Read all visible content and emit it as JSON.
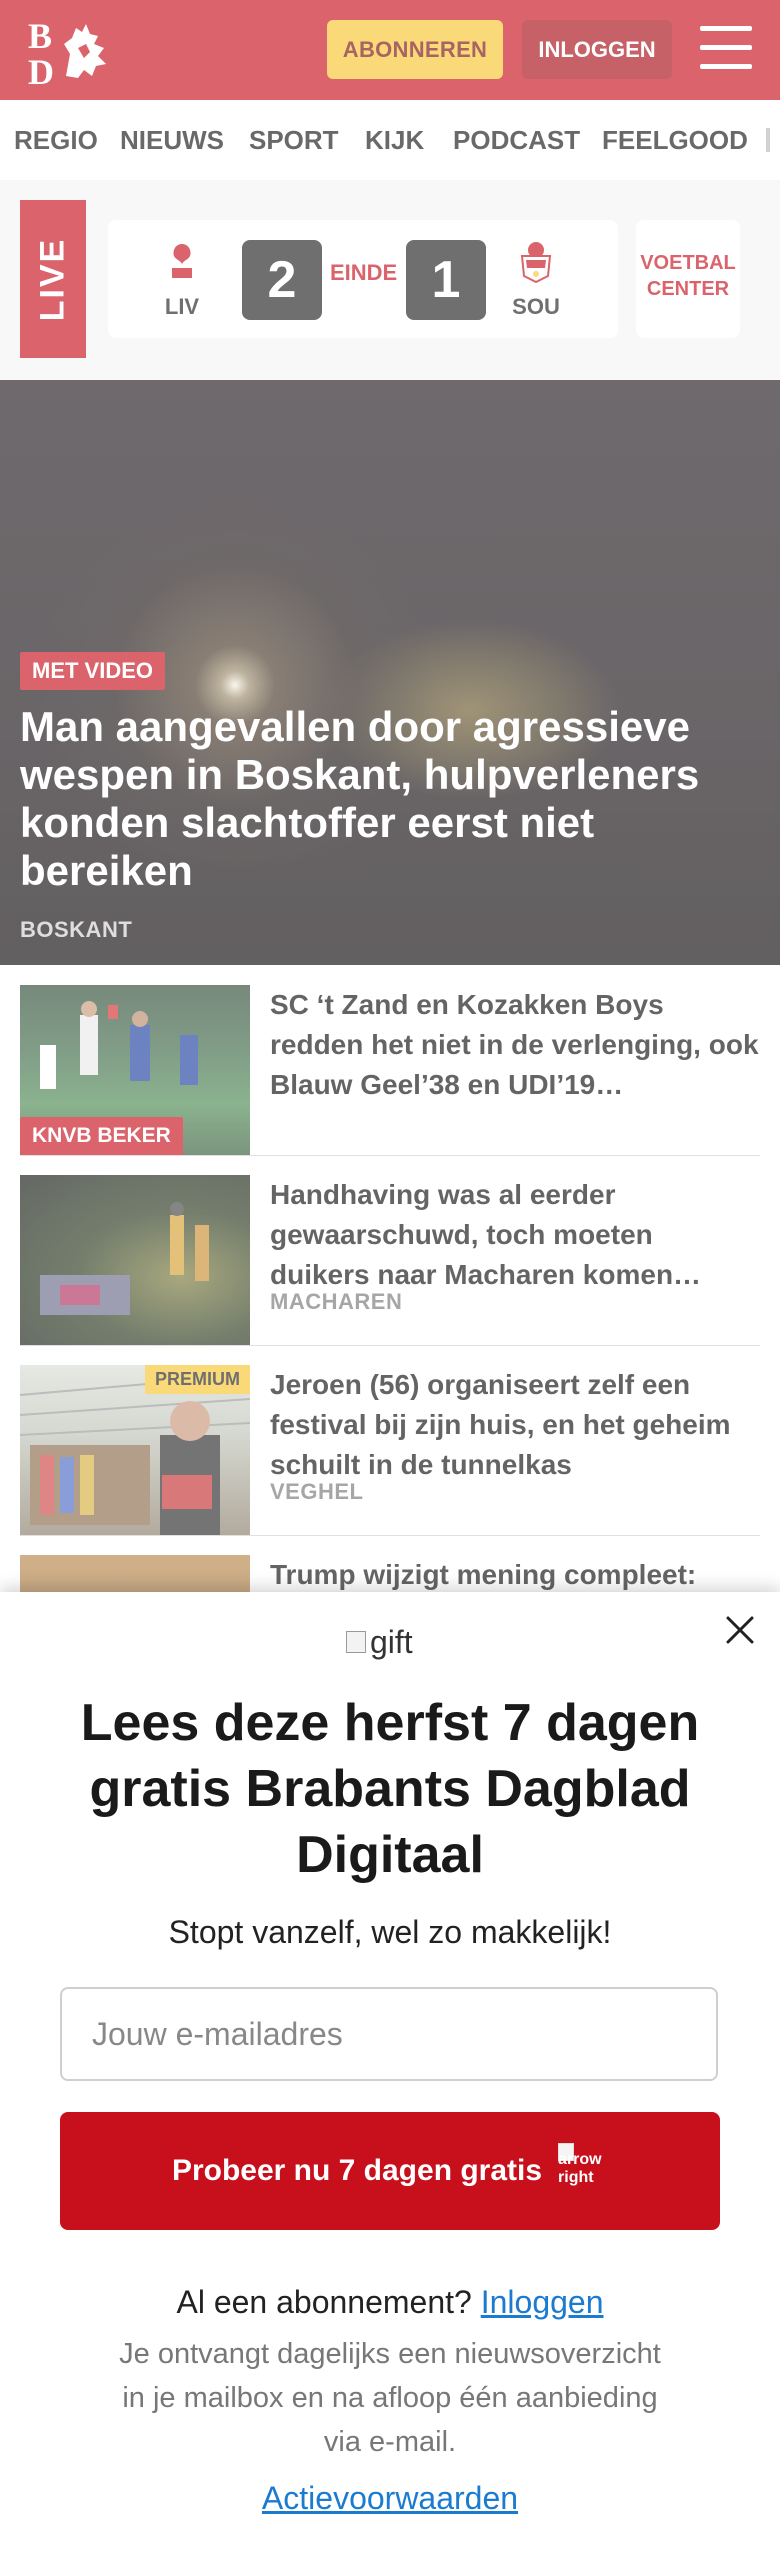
{
  "header": {
    "logo_text": "BD",
    "subscribe_label": "ABONNEREN",
    "login_label": "INLOGGEN",
    "brand_color": "#c8101c"
  },
  "nav": {
    "items": [
      "REGIO",
      "NIEUWS",
      "SPORT",
      "KIJK",
      "PODCAST",
      "FEELGOOD"
    ]
  },
  "live": {
    "label": "LIVE",
    "home_team": "LIV",
    "home_score": "2",
    "status": "EINDE",
    "away_score": "1",
    "away_team": "SOU",
    "center_label": "VOETBAL CENTER"
  },
  "hero": {
    "badge": "MET VIDEO",
    "title": "Man aangevallen door agressieve wespen in Boskant, hulpverleners konden slachtoffer eerst niet bereiken",
    "location": "BOSKANT"
  },
  "articles": [
    {
      "title": "SC ‘t Zand en Kozakken Boys redden het niet in de verlenging, ook Blauw Geel’38 en UDI’19…",
      "badge": "KNVB BEKER",
      "location": ""
    },
    {
      "title": "Handhaving was al eerder gewaarschuwd, toch moeten duikers naar Macharen komen…",
      "badge": "",
      "location": "MACHAREN"
    },
    {
      "title": "Jeroen (56) organiseert zelf een festival bij zijn huis, en het geheim schuilt in de tunnelkas",
      "badge": "PREMIUM",
      "location": "VEGHEL"
    },
    {
      "title": "Trump wijzigt mening compleet:",
      "badge": "",
      "location": ""
    }
  ],
  "popup": {
    "gift_alt": "gift",
    "title": "Lees deze herfst 7 dagen gratis Brabants Dagblad Digitaal",
    "subtitle": "Stopt vanzelf, wel zo makkelijk!",
    "email_placeholder": "Jouw e-mailadres",
    "cta_label": "Probeer nu 7 dagen gratis",
    "cta_icon_alt": "arrow right",
    "already_text": "Al een abonnement?",
    "login_link": "Inloggen",
    "fineprint": "Je ontvangt dagelijks een nieuwsoverzicht in je mailbox en na afloop één aanbieding via e-mail.",
    "terms_link": "Actievoorwaarden"
  }
}
